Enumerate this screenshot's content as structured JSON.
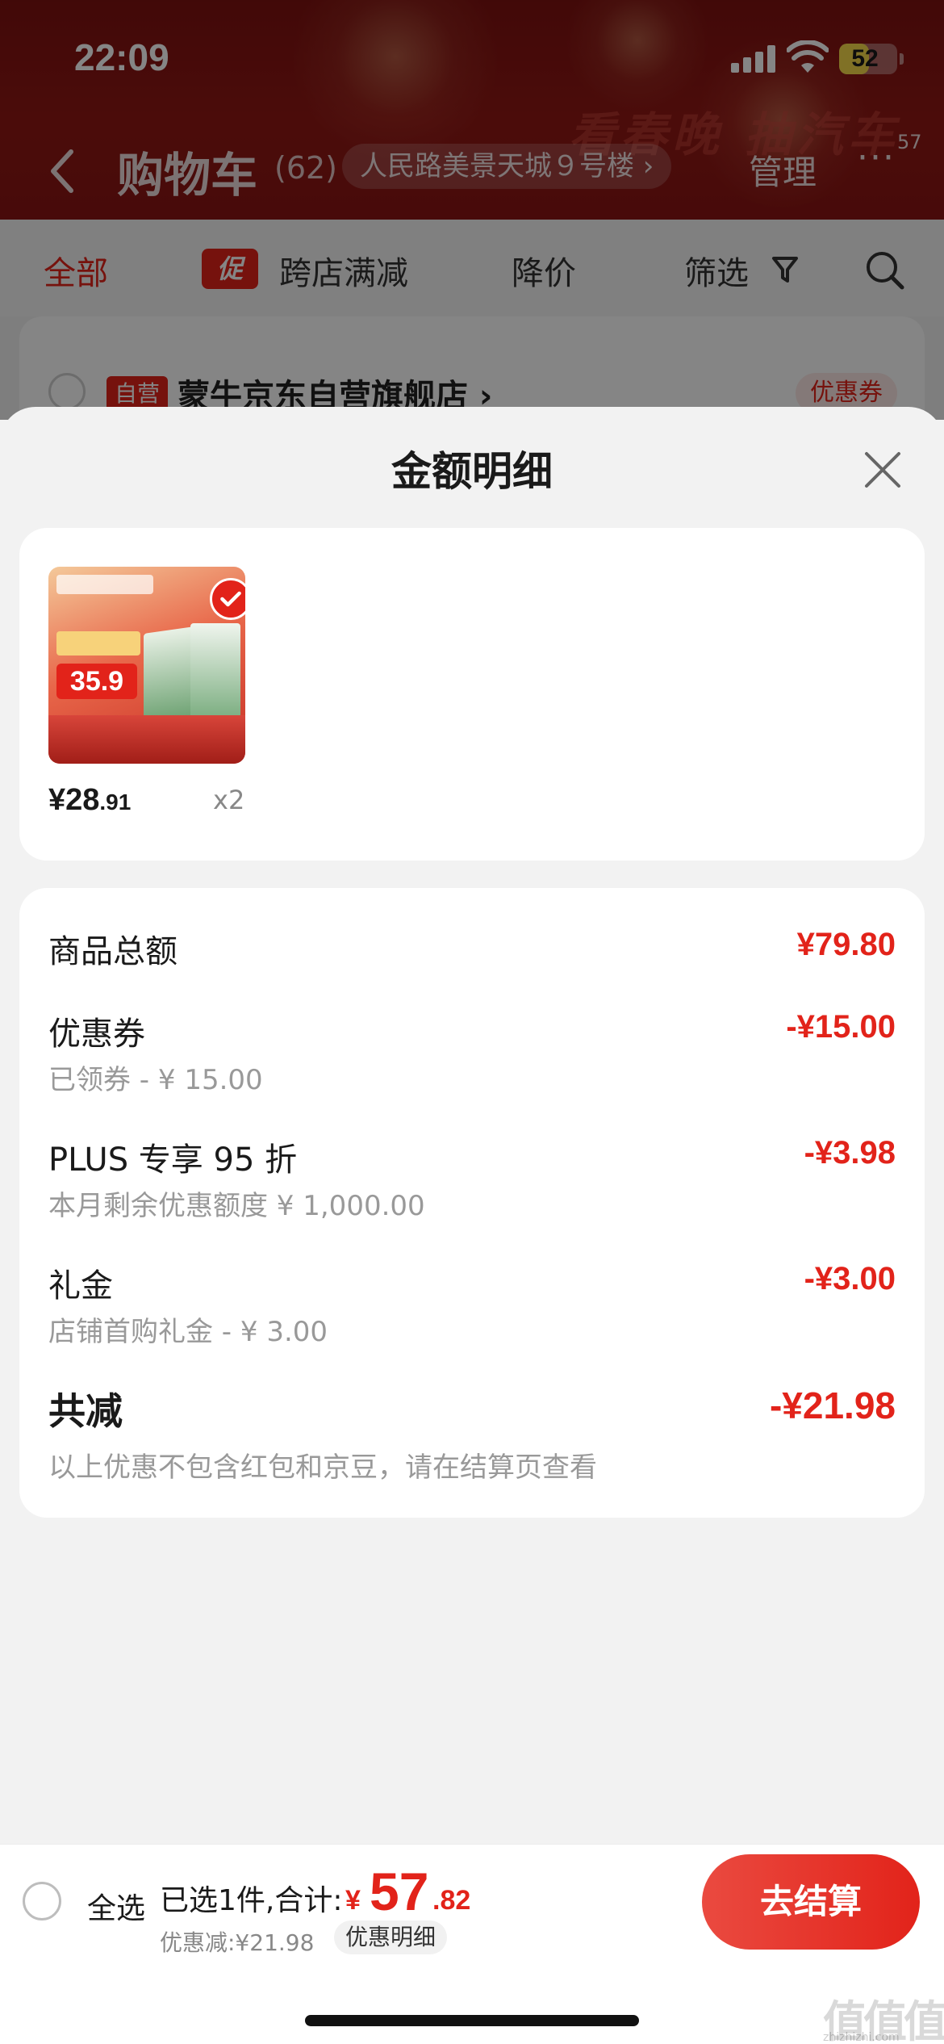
{
  "status_bar": {
    "time": "22:09",
    "battery": "52",
    "battery_level": 0.52
  },
  "header": {
    "title": "购物车",
    "count": "(62)",
    "address": "人民路美景天城９号楼 ›",
    "manage": "管理",
    "more": "···",
    "badge": "57",
    "festive": "看春晚 抽汽车"
  },
  "filters": {
    "all": "全部",
    "promo_badge": "促",
    "cross_store": "跨店满减",
    "price_drop": "降价",
    "filter": "筛选"
  },
  "store": {
    "tag": "自营",
    "name": "蒙牛京东自营旗舰店 ›",
    "coupon": "优惠券"
  },
  "sheet": {
    "title": "金额明细",
    "product": {
      "thumb_price": "35.9",
      "price_int": "¥28",
      "price_dec": ".91",
      "qty": "x2"
    },
    "rows": {
      "subtotal_label": "商品总额",
      "subtotal_value": "¥79.80",
      "coupon_label": "优惠券",
      "coupon_sub": "已领券 - ¥ 15.00",
      "coupon_value": "-¥15.00",
      "plus_label": "PLUS 专享 95 折",
      "plus_sub": "本月剩余优惠额度  ¥ 1,000.00",
      "plus_value": "-¥3.98",
      "gift_label": "礼金",
      "gift_sub": "店铺首购礼金 - ¥ 3.00",
      "gift_value": "-¥3.00",
      "total_label": "共减",
      "total_value": "-¥21.98",
      "note": "以上优惠不包含红包和京豆，请在结算页查看"
    }
  },
  "checkout": {
    "select_all": "全选",
    "summary": "已选1件,合计:",
    "symbol": "¥",
    "total_int": "57",
    "total_dec": ".82",
    "discount": "优惠减:¥21.98",
    "discount_detail": "优惠明细",
    "button": "去结算"
  },
  "watermark": {
    "logo": "值值值",
    "site": "zhizhizhi.com"
  },
  "colors": {
    "accent": "#e2231a",
    "header": "#8a1514"
  }
}
